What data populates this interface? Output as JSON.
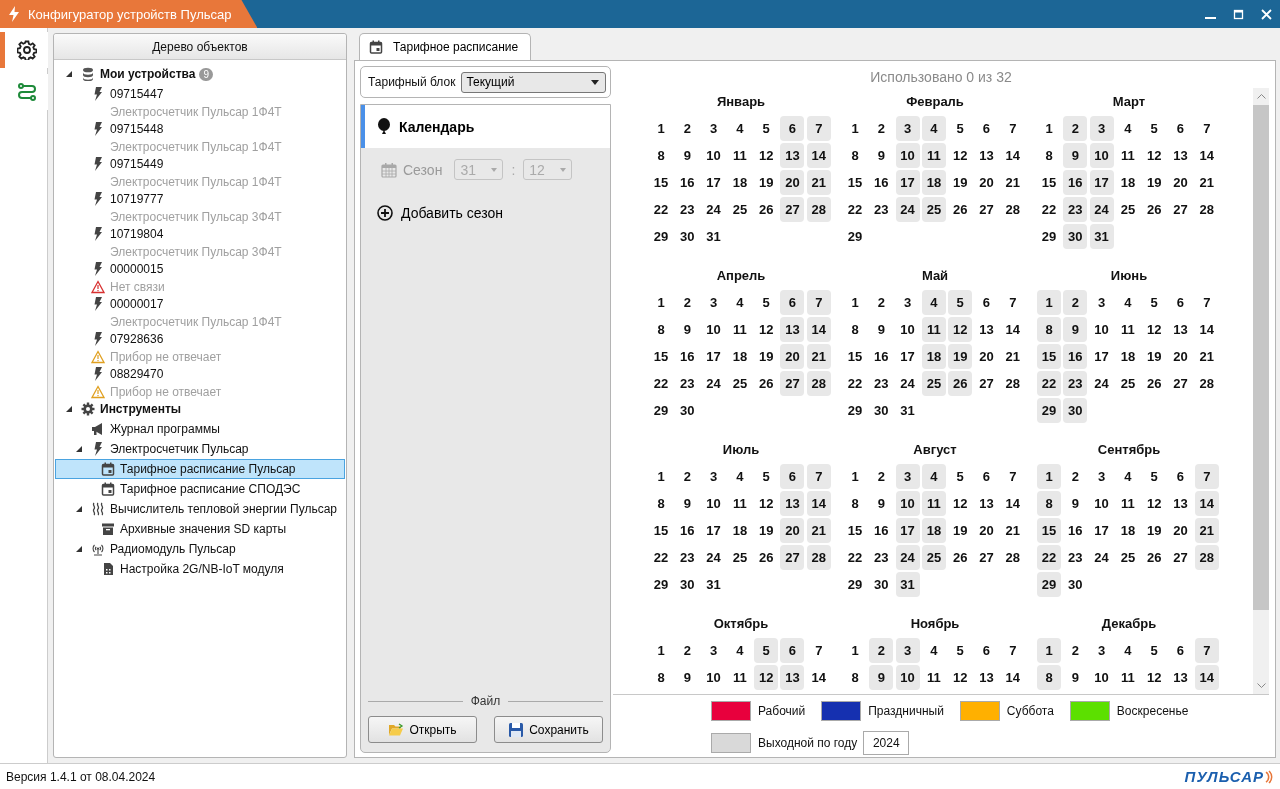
{
  "window": {
    "title": "Конфигуратор устройств Пульсар"
  },
  "sidebar": {
    "items": [
      {
        "kind": "settings",
        "selected": true
      },
      {
        "kind": "route",
        "selected": false
      }
    ]
  },
  "tree": {
    "title": "Дерево объектов",
    "items": [
      {
        "kind": "database",
        "label": "Мои устройства",
        "badge": "9",
        "expanded": true,
        "selected": false,
        "children": [
          {
            "kind": "bolt",
            "label": "09715447",
            "detail": {
              "kind": "model",
              "text": "Электросчетчик Пульсар 1Ф4Т"
            },
            "selected": false
          },
          {
            "kind": "bolt",
            "label": "09715448",
            "detail": {
              "kind": "model",
              "text": "Электросчетчик Пульсар 1Ф4Т"
            },
            "selected": false
          },
          {
            "kind": "bolt",
            "label": "09715449",
            "detail": {
              "kind": "model",
              "text": "Электросчетчик Пульсар 1Ф4Т"
            },
            "selected": false
          },
          {
            "kind": "bolt",
            "label": "10719777",
            "detail": {
              "kind": "model",
              "text": "Электросчетчик Пульсар 3Ф4Т"
            },
            "selected": false
          },
          {
            "kind": "bolt",
            "label": "10719804",
            "detail": {
              "kind": "model",
              "text": "Электросчетчик Пульсар 3Ф4Т"
            },
            "selected": false
          },
          {
            "kind": "bolt",
            "label": "00000015",
            "detail": {
              "kind": "error",
              "text": "Нет связи"
            },
            "selected": false
          },
          {
            "kind": "bolt",
            "label": "00000017",
            "detail": {
              "kind": "model",
              "text": "Электросчетчик Пульсар 1Ф4Т"
            },
            "selected": false
          },
          {
            "kind": "bolt",
            "label": "07928636",
            "detail": {
              "kind": "warning",
              "text": "Прибор не отвечает"
            },
            "selected": false
          },
          {
            "kind": "bolt",
            "label": "08829470",
            "detail": {
              "kind": "warning",
              "text": "Прибор не отвечает"
            },
            "selected": false
          }
        ]
      },
      {
        "kind": "gear",
        "label": "Инструменты",
        "expanded": true,
        "selected": false,
        "children": [
          {
            "kind": "megaphone",
            "label": "Журнал программы",
            "selected": false
          },
          {
            "kind": "bolt",
            "label": "Электросчетчик Пульсар",
            "expanded": true,
            "selected": false,
            "children": [
              {
                "kind": "calendar",
                "label": "Тарифное расписание Пульсар",
                "selected": true
              },
              {
                "kind": "calendar",
                "label": "Тарифное расписание СПОДЭС",
                "selected": false
              }
            ]
          },
          {
            "kind": "heat",
            "label": "Вычислитель тепловой энергии Пульсар",
            "expanded": true,
            "selected": false,
            "children": [
              {
                "kind": "archive",
                "label": "Архивные значения SD карты",
                "selected": false
              }
            ]
          },
          {
            "kind": "radio",
            "label": "Радиомодуль Пульсар",
            "expanded": true,
            "selected": false,
            "children": [
              {
                "kind": "sim",
                "label": "Настройка 2G/NB-IoT модуля",
                "selected": false
              }
            ]
          }
        ]
      }
    ]
  },
  "tabs": [
    {
      "label": "Тарифное расписание",
      "selected": true
    }
  ],
  "tariff_block": {
    "label": "Тарифный блок",
    "value": "Текущий"
  },
  "nav": [
    {
      "kind": "calendar",
      "label": "Календарь",
      "selected": true,
      "disabled": false
    },
    {
      "kind": "season",
      "label": "Сезон",
      "day": "31",
      "separator": ":",
      "month": "12",
      "selected": false,
      "disabled": true
    },
    {
      "kind": "add",
      "label": "Добавить сезон",
      "selected": false,
      "disabled": false
    }
  ],
  "file": {
    "title": "Файл",
    "buttons": [
      {
        "kind": "open",
        "label": "Открыть"
      },
      {
        "kind": "save",
        "label": "Сохранить"
      }
    ]
  },
  "calendar": {
    "usage": "Использовано 0 из 32",
    "months": [
      {
        "name": "Январь",
        "days": [
          {
            "n": "1",
            "off": false
          },
          {
            "n": "2",
            "off": false
          },
          {
            "n": "3",
            "off": false
          },
          {
            "n": "4",
            "off": false
          },
          {
            "n": "5",
            "off": false
          },
          {
            "n": "6",
            "off": true
          },
          {
            "n": "7",
            "off": true
          },
          {
            "n": "8",
            "off": false
          },
          {
            "n": "9",
            "off": false
          },
          {
            "n": "10",
            "off": false
          },
          {
            "n": "11",
            "off": false
          },
          {
            "n": "12",
            "off": false
          },
          {
            "n": "13",
            "off": true
          },
          {
            "n": "14",
            "off": true
          },
          {
            "n": "15",
            "off": false
          },
          {
            "n": "16",
            "off": false
          },
          {
            "n": "17",
            "off": false
          },
          {
            "n": "18",
            "off": false
          },
          {
            "n": "19",
            "off": false
          },
          {
            "n": "20",
            "off": true
          },
          {
            "n": "21",
            "off": true
          },
          {
            "n": "22",
            "off": false
          },
          {
            "n": "23",
            "off": false
          },
          {
            "n": "24",
            "off": false
          },
          {
            "n": "25",
            "off": false
          },
          {
            "n": "26",
            "off": false
          },
          {
            "n": "27",
            "off": true
          },
          {
            "n": "28",
            "off": true
          },
          {
            "n": "29",
            "off": false
          },
          {
            "n": "30",
            "off": false
          },
          {
            "n": "31",
            "off": false
          }
        ]
      },
      {
        "name": "Февраль",
        "days": [
          {
            "n": "1",
            "off": false
          },
          {
            "n": "2",
            "off": false
          },
          {
            "n": "3",
            "off": true
          },
          {
            "n": "4",
            "off": true
          },
          {
            "n": "5",
            "off": false
          },
          {
            "n": "6",
            "off": false
          },
          {
            "n": "7",
            "off": false
          },
          {
            "n": "8",
            "off": false
          },
          {
            "n": "9",
            "off": false
          },
          {
            "n": "10",
            "off": true
          },
          {
            "n": "11",
            "off": true
          },
          {
            "n": "12",
            "off": false
          },
          {
            "n": "13",
            "off": false
          },
          {
            "n": "14",
            "off": false
          },
          {
            "n": "15",
            "off": false
          },
          {
            "n": "16",
            "off": false
          },
          {
            "n": "17",
            "off": true
          },
          {
            "n": "18",
            "off": true
          },
          {
            "n": "19",
            "off": false
          },
          {
            "n": "20",
            "off": false
          },
          {
            "n": "21",
            "off": false
          },
          {
            "n": "22",
            "off": false
          },
          {
            "n": "23",
            "off": false
          },
          {
            "n": "24",
            "off": true
          },
          {
            "n": "25",
            "off": true
          },
          {
            "n": "26",
            "off": false
          },
          {
            "n": "27",
            "off": false
          },
          {
            "n": "28",
            "off": false
          },
          {
            "n": "29",
            "off": false
          }
        ]
      },
      {
        "name": "Март",
        "days": [
          {
            "n": "1",
            "off": false
          },
          {
            "n": "2",
            "off": true
          },
          {
            "n": "3",
            "off": true
          },
          {
            "n": "4",
            "off": false
          },
          {
            "n": "5",
            "off": false
          },
          {
            "n": "6",
            "off": false
          },
          {
            "n": "7",
            "off": false
          },
          {
            "n": "8",
            "off": false
          },
          {
            "n": "9",
            "off": true
          },
          {
            "n": "10",
            "off": true
          },
          {
            "n": "11",
            "off": false
          },
          {
            "n": "12",
            "off": false
          },
          {
            "n": "13",
            "off": false
          },
          {
            "n": "14",
            "off": false
          },
          {
            "n": "15",
            "off": false
          },
          {
            "n": "16",
            "off": true
          },
          {
            "n": "17",
            "off": true
          },
          {
            "n": "18",
            "off": false
          },
          {
            "n": "19",
            "off": false
          },
          {
            "n": "20",
            "off": false
          },
          {
            "n": "21",
            "off": false
          },
          {
            "n": "22",
            "off": false
          },
          {
            "n": "23",
            "off": true
          },
          {
            "n": "24",
            "off": true
          },
          {
            "n": "25",
            "off": false
          },
          {
            "n": "26",
            "off": false
          },
          {
            "n": "27",
            "off": false
          },
          {
            "n": "28",
            "off": false
          },
          {
            "n": "29",
            "off": false
          },
          {
            "n": "30",
            "off": true
          },
          {
            "n": "31",
            "off": true
          }
        ]
      },
      {
        "name": "Апрель",
        "days": [
          {
            "n": "1",
            "off": false
          },
          {
            "n": "2",
            "off": false
          },
          {
            "n": "3",
            "off": false
          },
          {
            "n": "4",
            "off": false
          },
          {
            "n": "5",
            "off": false
          },
          {
            "n": "6",
            "off": true
          },
          {
            "n": "7",
            "off": true
          },
          {
            "n": "8",
            "off": false
          },
          {
            "n": "9",
            "off": false
          },
          {
            "n": "10",
            "off": false
          },
          {
            "n": "11",
            "off": false
          },
          {
            "n": "12",
            "off": false
          },
          {
            "n": "13",
            "off": true
          },
          {
            "n": "14",
            "off": true
          },
          {
            "n": "15",
            "off": false
          },
          {
            "n": "16",
            "off": false
          },
          {
            "n": "17",
            "off": false
          },
          {
            "n": "18",
            "off": false
          },
          {
            "n": "19",
            "off": false
          },
          {
            "n": "20",
            "off": true
          },
          {
            "n": "21",
            "off": true
          },
          {
            "n": "22",
            "off": false
          },
          {
            "n": "23",
            "off": false
          },
          {
            "n": "24",
            "off": false
          },
          {
            "n": "25",
            "off": false
          },
          {
            "n": "26",
            "off": false
          },
          {
            "n": "27",
            "off": true
          },
          {
            "n": "28",
            "off": true
          },
          {
            "n": "29",
            "off": false
          },
          {
            "n": "30",
            "off": false
          }
        ]
      },
      {
        "name": "Май",
        "days": [
          {
            "n": "1",
            "off": false
          },
          {
            "n": "2",
            "off": false
          },
          {
            "n": "3",
            "off": false
          },
          {
            "n": "4",
            "off": true
          },
          {
            "n": "5",
            "off": true
          },
          {
            "n": "6",
            "off": false
          },
          {
            "n": "7",
            "off": false
          },
          {
            "n": "8",
            "off": false
          },
          {
            "n": "9",
            "off": false
          },
          {
            "n": "10",
            "off": false
          },
          {
            "n": "11",
            "off": true
          },
          {
            "n": "12",
            "off": true
          },
          {
            "n": "13",
            "off": false
          },
          {
            "n": "14",
            "off": false
          },
          {
            "n": "15",
            "off": false
          },
          {
            "n": "16",
            "off": false
          },
          {
            "n": "17",
            "off": false
          },
          {
            "n": "18",
            "off": true
          },
          {
            "n": "19",
            "off": true
          },
          {
            "n": "20",
            "off": false
          },
          {
            "n": "21",
            "off": false
          },
          {
            "n": "22",
            "off": false
          },
          {
            "n": "23",
            "off": false
          },
          {
            "n": "24",
            "off": false
          },
          {
            "n": "25",
            "off": true
          },
          {
            "n": "26",
            "off": true
          },
          {
            "n": "27",
            "off": false
          },
          {
            "n": "28",
            "off": false
          },
          {
            "n": "29",
            "off": false
          },
          {
            "n": "30",
            "off": false
          },
          {
            "n": "31",
            "off": false
          }
        ]
      },
      {
        "name": "Июнь",
        "days": [
          {
            "n": "1",
            "off": true
          },
          {
            "n": "2",
            "off": true
          },
          {
            "n": "3",
            "off": false
          },
          {
            "n": "4",
            "off": false
          },
          {
            "n": "5",
            "off": false
          },
          {
            "n": "6",
            "off": false
          },
          {
            "n": "7",
            "off": false
          },
          {
            "n": "8",
            "off": true
          },
          {
            "n": "9",
            "off": true
          },
          {
            "n": "10",
            "off": false
          },
          {
            "n": "11",
            "off": false
          },
          {
            "n": "12",
            "off": false
          },
          {
            "n": "13",
            "off": false
          },
          {
            "n": "14",
            "off": false
          },
          {
            "n": "15",
            "off": true
          },
          {
            "n": "16",
            "off": true
          },
          {
            "n": "17",
            "off": false
          },
          {
            "n": "18",
            "off": false
          },
          {
            "n": "19",
            "off": false
          },
          {
            "n": "20",
            "off": false
          },
          {
            "n": "21",
            "off": false
          },
          {
            "n": "22",
            "off": true
          },
          {
            "n": "23",
            "off": true
          },
          {
            "n": "24",
            "off": false
          },
          {
            "n": "25",
            "off": false
          },
          {
            "n": "26",
            "off": false
          },
          {
            "n": "27",
            "off": false
          },
          {
            "n": "28",
            "off": false
          },
          {
            "n": "29",
            "off": true
          },
          {
            "n": "30",
            "off": true
          }
        ]
      },
      {
        "name": "Июль",
        "days": [
          {
            "n": "1",
            "off": false
          },
          {
            "n": "2",
            "off": false
          },
          {
            "n": "3",
            "off": false
          },
          {
            "n": "4",
            "off": false
          },
          {
            "n": "5",
            "off": false
          },
          {
            "n": "6",
            "off": true
          },
          {
            "n": "7",
            "off": true
          },
          {
            "n": "8",
            "off": false
          },
          {
            "n": "9",
            "off": false
          },
          {
            "n": "10",
            "off": false
          },
          {
            "n": "11",
            "off": false
          },
          {
            "n": "12",
            "off": false
          },
          {
            "n": "13",
            "off": true
          },
          {
            "n": "14",
            "off": true
          },
          {
            "n": "15",
            "off": false
          },
          {
            "n": "16",
            "off": false
          },
          {
            "n": "17",
            "off": false
          },
          {
            "n": "18",
            "off": false
          },
          {
            "n": "19",
            "off": false
          },
          {
            "n": "20",
            "off": true
          },
          {
            "n": "21",
            "off": true
          },
          {
            "n": "22",
            "off": false
          },
          {
            "n": "23",
            "off": false
          },
          {
            "n": "24",
            "off": false
          },
          {
            "n": "25",
            "off": false
          },
          {
            "n": "26",
            "off": false
          },
          {
            "n": "27",
            "off": true
          },
          {
            "n": "28",
            "off": true
          },
          {
            "n": "29",
            "off": false
          },
          {
            "n": "30",
            "off": false
          },
          {
            "n": "31",
            "off": false
          }
        ]
      },
      {
        "name": "Август",
        "days": [
          {
            "n": "1",
            "off": false
          },
          {
            "n": "2",
            "off": false
          },
          {
            "n": "3",
            "off": true
          },
          {
            "n": "4",
            "off": true
          },
          {
            "n": "5",
            "off": false
          },
          {
            "n": "6",
            "off": false
          },
          {
            "n": "7",
            "off": false
          },
          {
            "n": "8",
            "off": false
          },
          {
            "n": "9",
            "off": false
          },
          {
            "n": "10",
            "off": true
          },
          {
            "n": "11",
            "off": true
          },
          {
            "n": "12",
            "off": false
          },
          {
            "n": "13",
            "off": false
          },
          {
            "n": "14",
            "off": false
          },
          {
            "n": "15",
            "off": false
          },
          {
            "n": "16",
            "off": false
          },
          {
            "n": "17",
            "off": true
          },
          {
            "n": "18",
            "off": true
          },
          {
            "n": "19",
            "off": false
          },
          {
            "n": "20",
            "off": false
          },
          {
            "n": "21",
            "off": false
          },
          {
            "n": "22",
            "off": false
          },
          {
            "n": "23",
            "off": false
          },
          {
            "n": "24",
            "off": true
          },
          {
            "n": "25",
            "off": true
          },
          {
            "n": "26",
            "off": false
          },
          {
            "n": "27",
            "off": false
          },
          {
            "n": "28",
            "off": false
          },
          {
            "n": "29",
            "off": false
          },
          {
            "n": "30",
            "off": false
          },
          {
            "n": "31",
            "off": true
          }
        ]
      },
      {
        "name": "Сентябрь",
        "days": [
          {
            "n": "1",
            "off": true
          },
          {
            "n": "2",
            "off": false
          },
          {
            "n": "3",
            "off": false
          },
          {
            "n": "4",
            "off": false
          },
          {
            "n": "5",
            "off": false
          },
          {
            "n": "6",
            "off": false
          },
          {
            "n": "7",
            "off": true
          },
          {
            "n": "8",
            "off": true
          },
          {
            "n": "9",
            "off": false
          },
          {
            "n": "10",
            "off": false
          },
          {
            "n": "11",
            "off": false
          },
          {
            "n": "12",
            "off": false
          },
          {
            "n": "13",
            "off": false
          },
          {
            "n": "14",
            "off": true
          },
          {
            "n": "15",
            "off": true
          },
          {
            "n": "16",
            "off": false
          },
          {
            "n": "17",
            "off": false
          },
          {
            "n": "18",
            "off": false
          },
          {
            "n": "19",
            "off": false
          },
          {
            "n": "20",
            "off": false
          },
          {
            "n": "21",
            "off": true
          },
          {
            "n": "22",
            "off": true
          },
          {
            "n": "23",
            "off": false
          },
          {
            "n": "24",
            "off": false
          },
          {
            "n": "25",
            "off": false
          },
          {
            "n": "26",
            "off": false
          },
          {
            "n": "27",
            "off": false
          },
          {
            "n": "28",
            "off": true
          },
          {
            "n": "29",
            "off": true
          },
          {
            "n": "30",
            "off": false
          }
        ]
      },
      {
        "name": "Октябрь",
        "days": [
          {
            "n": "1",
            "off": false
          },
          {
            "n": "2",
            "off": false
          },
          {
            "n": "3",
            "off": false
          },
          {
            "n": "4",
            "off": false
          },
          {
            "n": "5",
            "off": true
          },
          {
            "n": "6",
            "off": true
          },
          {
            "n": "7",
            "off": false
          },
          {
            "n": "8",
            "off": false
          },
          {
            "n": "9",
            "off": false
          },
          {
            "n": "10",
            "off": false
          },
          {
            "n": "11",
            "off": false
          },
          {
            "n": "12",
            "off": true
          },
          {
            "n": "13",
            "off": true
          },
          {
            "n": "14",
            "off": false
          }
        ]
      },
      {
        "name": "Ноябрь",
        "days": [
          {
            "n": "1",
            "off": false
          },
          {
            "n": "2",
            "off": true
          },
          {
            "n": "3",
            "off": true
          },
          {
            "n": "4",
            "off": false
          },
          {
            "n": "5",
            "off": false
          },
          {
            "n": "6",
            "off": false
          },
          {
            "n": "7",
            "off": false
          },
          {
            "n": "8",
            "off": false
          },
          {
            "n": "9",
            "off": true
          },
          {
            "n": "10",
            "off": true
          },
          {
            "n": "11",
            "off": false
          },
          {
            "n": "12",
            "off": false
          },
          {
            "n": "13",
            "off": false
          },
          {
            "n": "14",
            "off": false
          }
        ]
      },
      {
        "name": "Декабрь",
        "days": [
          {
            "n": "1",
            "off": true
          },
          {
            "n": "2",
            "off": false
          },
          {
            "n": "3",
            "off": false
          },
          {
            "n": "4",
            "off": false
          },
          {
            "n": "5",
            "off": false
          },
          {
            "n": "6",
            "off": false
          },
          {
            "n": "7",
            "off": true
          },
          {
            "n": "8",
            "off": true
          },
          {
            "n": "9",
            "off": false
          },
          {
            "n": "10",
            "off": false
          },
          {
            "n": "11",
            "off": false
          },
          {
            "n": "12",
            "off": false
          },
          {
            "n": "13",
            "off": false
          },
          {
            "n": "14",
            "off": true
          }
        ]
      }
    ]
  },
  "legend": {
    "items": [
      {
        "label": "Рабочий",
        "color": "#e8003d"
      },
      {
        "label": "Праздничный",
        "color": "#1530b0"
      },
      {
        "label": "Суббота",
        "color": "#ffb000"
      },
      {
        "label": "Воскресенье",
        "color": "#5ce000"
      },
      {
        "label": "Выходной по году",
        "color": "#d9d9d9"
      }
    ],
    "year": "2024"
  },
  "status_bar": {
    "version": "Версия 1.4.1 от 08.04.2024",
    "logo": "ПУЛЬСАР"
  }
}
